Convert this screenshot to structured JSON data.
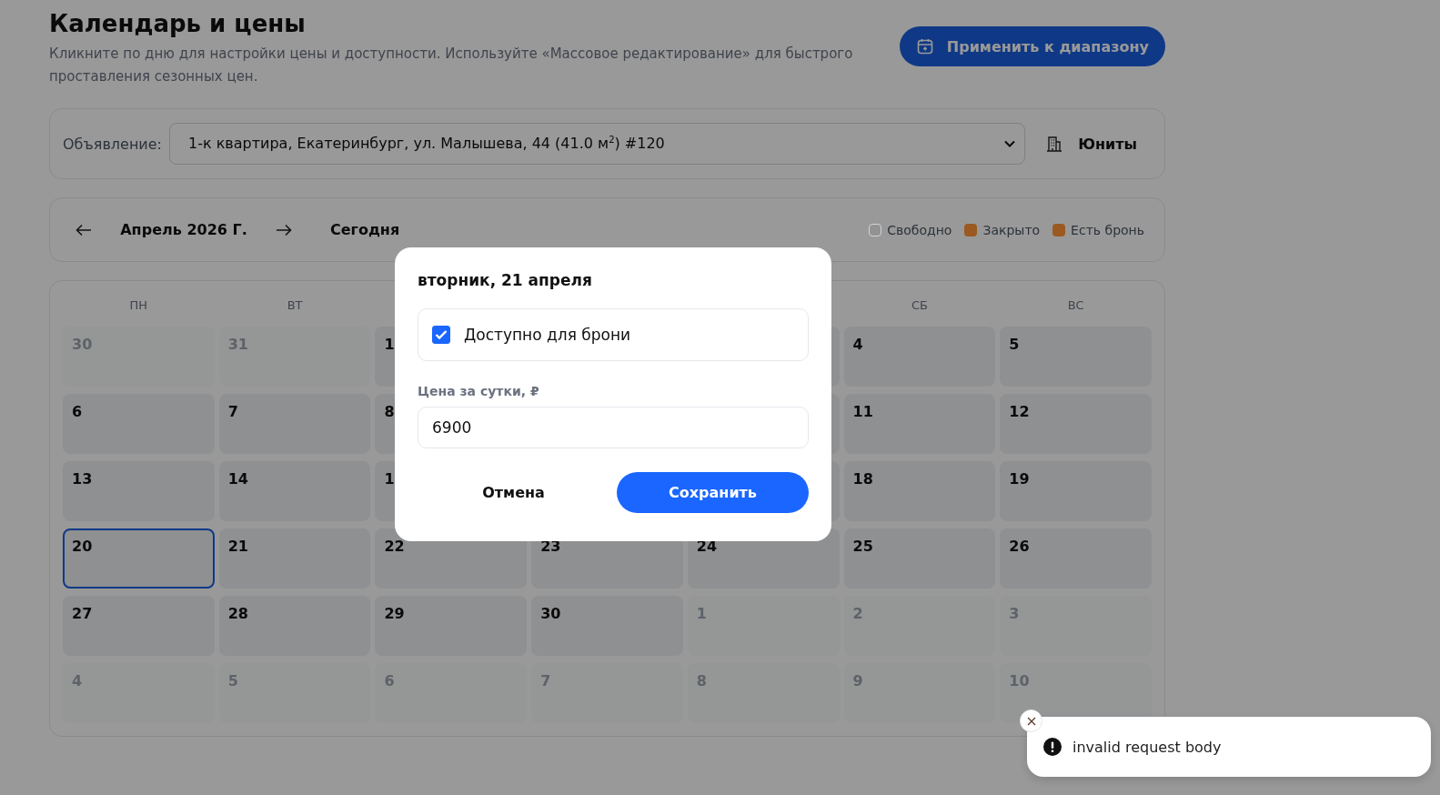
{
  "header": {
    "title": "Календарь и цены",
    "subtitle": "Кликните по дню для настройки цены и доступности. Используйте «Массовое редактирование» для быстрого проставления сезонных цен.",
    "apply_button": "Применить к диапазону"
  },
  "listing": {
    "label": "Объявление:",
    "value": "1-к квартира, Екатеринбург, ул. Малышева, 44 (41.0 м$^{2}$) #120",
    "units_button": "Юниты"
  },
  "nav": {
    "month": "Апрель 2026 Г.",
    "today_button": "Сегодня",
    "legend": [
      {
        "label": "Свободно",
        "kind": "free",
        "color": "#939393"
      },
      {
        "label": "Закрыто",
        "kind": "closed",
        "color": "#9a5a22"
      },
      {
        "label": "Есть бронь",
        "kind": "booked",
        "color": "#9a5a22"
      }
    ]
  },
  "calendar": {
    "weekdays": {
      "start": [
        {
          "label": "ПН"
        },
        {
          "label": "ВТ"
        }
      ],
      "end": [
        {
          "label": "СБ"
        },
        {
          "label": "ВС"
        }
      ]
    },
    "weeks": [
      {
        "start": [
          {
            "day": "30",
            "in_month": false,
            "today": false
          },
          {
            "day": "31",
            "in_month": false,
            "today": false
          },
          {
            "day": "1",
            "in_month": true,
            "today": false
          }
        ],
        "end": [
          {
            "day": "4",
            "in_month": true,
            "today": false
          },
          {
            "day": "5",
            "in_month": true,
            "today": false
          }
        ]
      },
      {
        "start": [
          {
            "day": "6",
            "in_month": true,
            "today": false
          },
          {
            "day": "7",
            "in_month": true,
            "today": false
          },
          {
            "day": "8",
            "in_month": true,
            "today": false
          }
        ],
        "end": [
          {
            "day": "11",
            "in_month": true,
            "today": false
          },
          {
            "day": "12",
            "in_month": true,
            "today": false
          }
        ]
      },
      {
        "start": [
          {
            "day": "13",
            "in_month": true,
            "today": false
          },
          {
            "day": "14",
            "in_month": true,
            "today": false
          },
          {
            "day": "1",
            "in_month": true,
            "today": false
          }
        ],
        "end": [
          {
            "day": "18",
            "in_month": true,
            "today": false
          },
          {
            "day": "19",
            "in_month": true,
            "today": false
          }
        ]
      },
      {
        "start": [
          {
            "day": "20",
            "in_month": true,
            "today": true
          },
          {
            "day": "21",
            "in_month": true,
            "today": false
          },
          {
            "day": "22",
            "in_month": true,
            "today": false
          },
          {
            "day": "23",
            "in_month": true,
            "today": false
          },
          {
            "day": "24",
            "in_month": true,
            "today": false
          },
          {
            "day": "25",
            "in_month": true,
            "today": false
          },
          {
            "day": "26",
            "in_month": true,
            "today": false
          }
        ]
      },
      {
        "start": [
          {
            "day": "27",
            "in_month": true,
            "today": false
          },
          {
            "day": "28",
            "in_month": true,
            "today": false
          },
          {
            "day": "29",
            "in_month": true,
            "today": false
          },
          {
            "day": "30",
            "in_month": true,
            "today": false
          },
          {
            "day": "1",
            "in_month": false,
            "today": false
          },
          {
            "day": "2",
            "in_month": false,
            "today": false
          },
          {
            "day": "3",
            "in_month": false,
            "today": false
          }
        ]
      },
      {
        "start": [
          {
            "day": "4",
            "in_month": false,
            "today": false
          },
          {
            "day": "5",
            "in_month": false,
            "today": false
          },
          {
            "day": "6",
            "in_month": false,
            "today": false
          },
          {
            "day": "7",
            "in_month": false,
            "today": false
          },
          {
            "day": "8",
            "in_month": false,
            "today": false
          },
          {
            "day": "9",
            "in_month": false,
            "today": false
          },
          {
            "day": "10",
            "in_month": false,
            "today": false
          }
        ]
      }
    ]
  },
  "dialog": {
    "title": "вторник, 21 апреля",
    "available": {
      "label": "Доступно для брони",
      "checked": true
    },
    "price_label": "Цена за сутки, ₽",
    "price_value": "6900",
    "cancel_button": "Отмена",
    "save_button": "Сохранить"
  },
  "toast": {
    "message": "invalid request body"
  }
}
